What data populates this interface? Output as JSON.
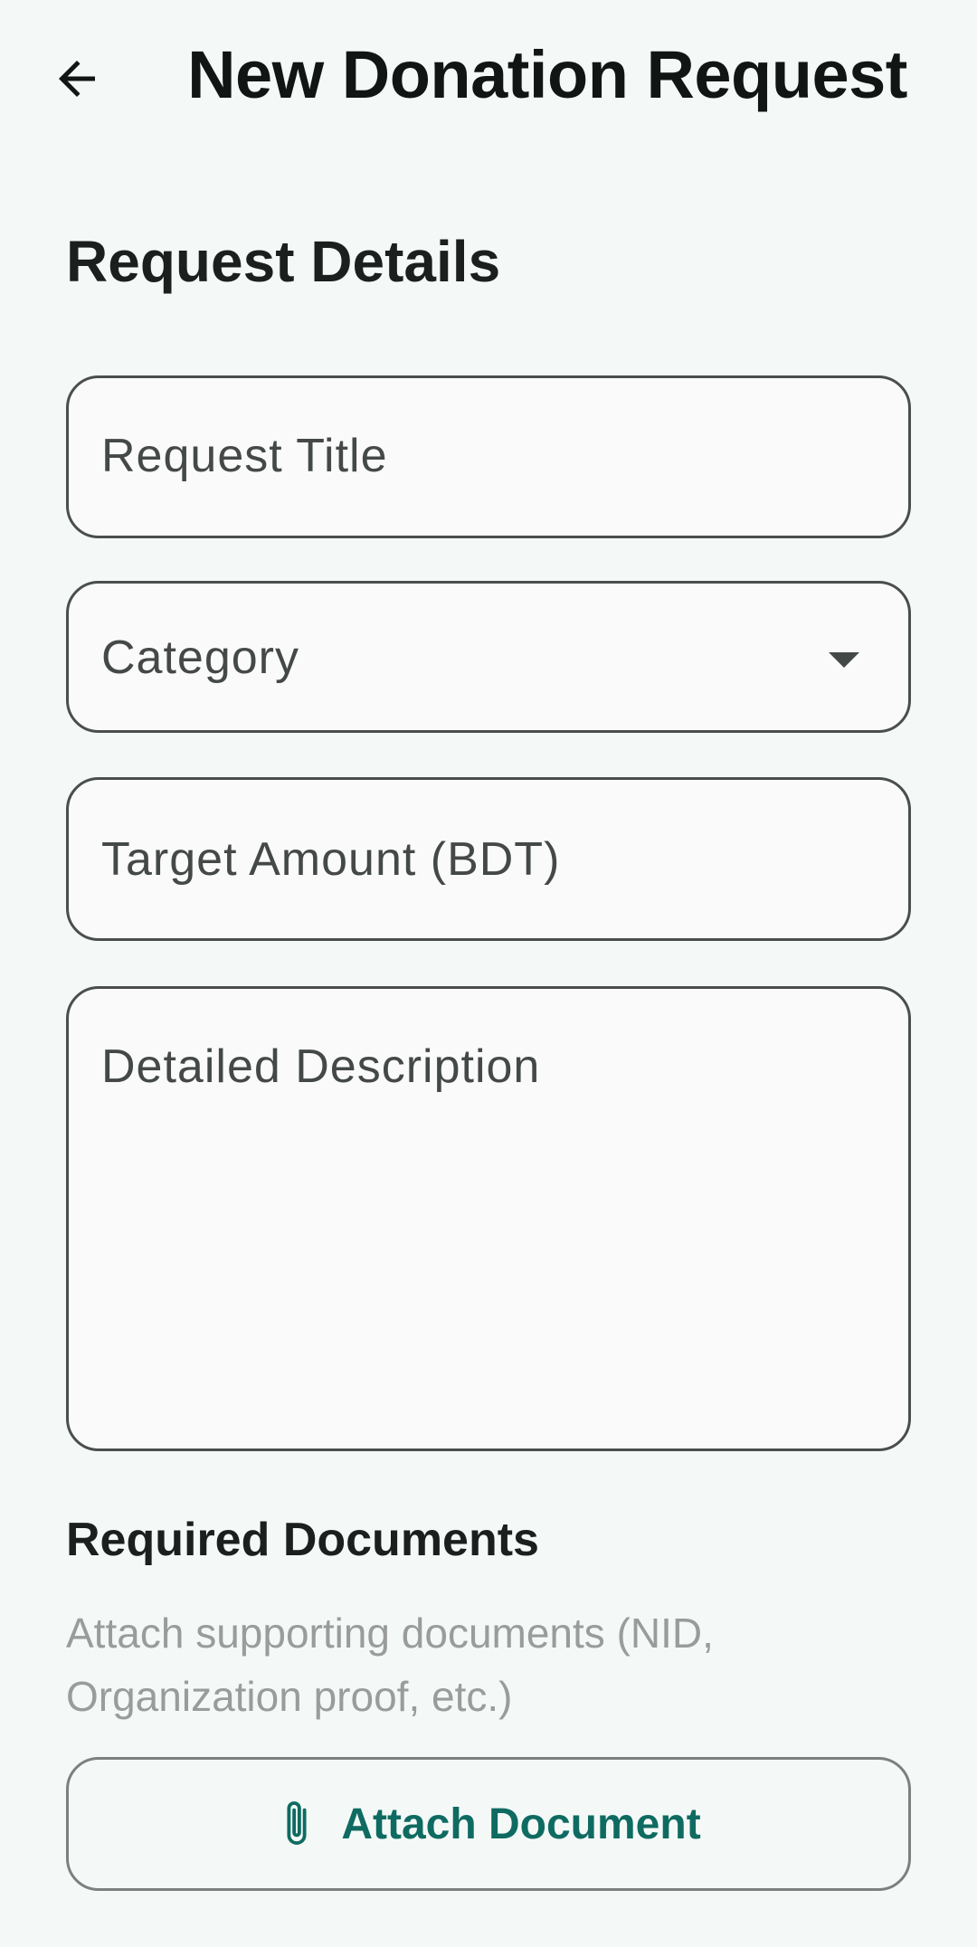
{
  "appbar": {
    "title": "New Donation Request",
    "back_icon": "arrow-left-icon"
  },
  "form": {
    "section_title": "Request Details",
    "title_placeholder": "Request Title",
    "category_placeholder": "Category",
    "amount_placeholder": "Target Amount (BDT)",
    "description_placeholder": "Detailed Description"
  },
  "documents": {
    "title": "Required Documents",
    "hint": "Attach supporting documents (NID, Organization proof, etc.)",
    "attach_label": "Attach Document",
    "attach_icon": "paperclip-icon"
  },
  "colors": {
    "background": "#f4f9f7",
    "accent": "#0f6b61",
    "field_border": "#4a4f4d",
    "hint_text": "#9a9c9b"
  }
}
